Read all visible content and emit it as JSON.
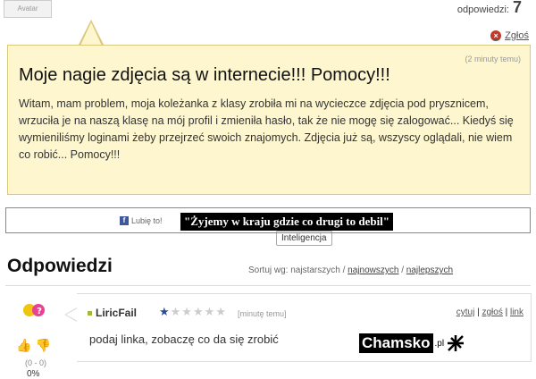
{
  "header": {
    "avatar_label": "Avatar",
    "answers_label": "odpowiedzi:",
    "answers_count": "7"
  },
  "question": {
    "report_label": "Zgłoś",
    "report_icon": "x-circle-icon",
    "time": "(2 minuty temu)",
    "title": "Moje nagie zdjęcia są w internecie!!! Pomocy!!!",
    "body": "Witam, mam problem, moja koleżanka z klasy zrobiła mi na wycieczce zdjęcia pod prysznicem, wrzuciła je na naszą klasę na mój profil i zmieniła hasło, tak że nie mogę się zalogować... Kiedyś się wymieniliśmy loginami żeby przejrzeć swoich znajomych. Zdjęcia już są, wszyscy oglądali, nie wiem co robić... Pomocy!!!",
    "category": "Inteligencja",
    "bg_color": "#fdf6cf"
  },
  "banner": {
    "like_label": "Lubię to!",
    "fb_icon": "facebook-icon",
    "slogan": "\"Żyjemy w kraju gdzie co drugi to debil\""
  },
  "answers": {
    "heading": "Odpowiedzi",
    "sort_prefix": "Sortuj wg: najstarszych",
    "sort_newest": "najnowszych",
    "sort_best": "najlepszych",
    "items": [
      {
        "user": "LiricFail",
        "rating_stars": 1,
        "rating_max": 6,
        "time": "[minutę temu]",
        "text": "podaj linka, zobaczę co da się zrobić",
        "score": "(0 - 0)",
        "percent": "0%",
        "actions": [
          "cytuj",
          "zgłoś",
          "link"
        ]
      }
    ]
  },
  "watermark": {
    "text": "Chamsko",
    "tld": ".pl"
  }
}
